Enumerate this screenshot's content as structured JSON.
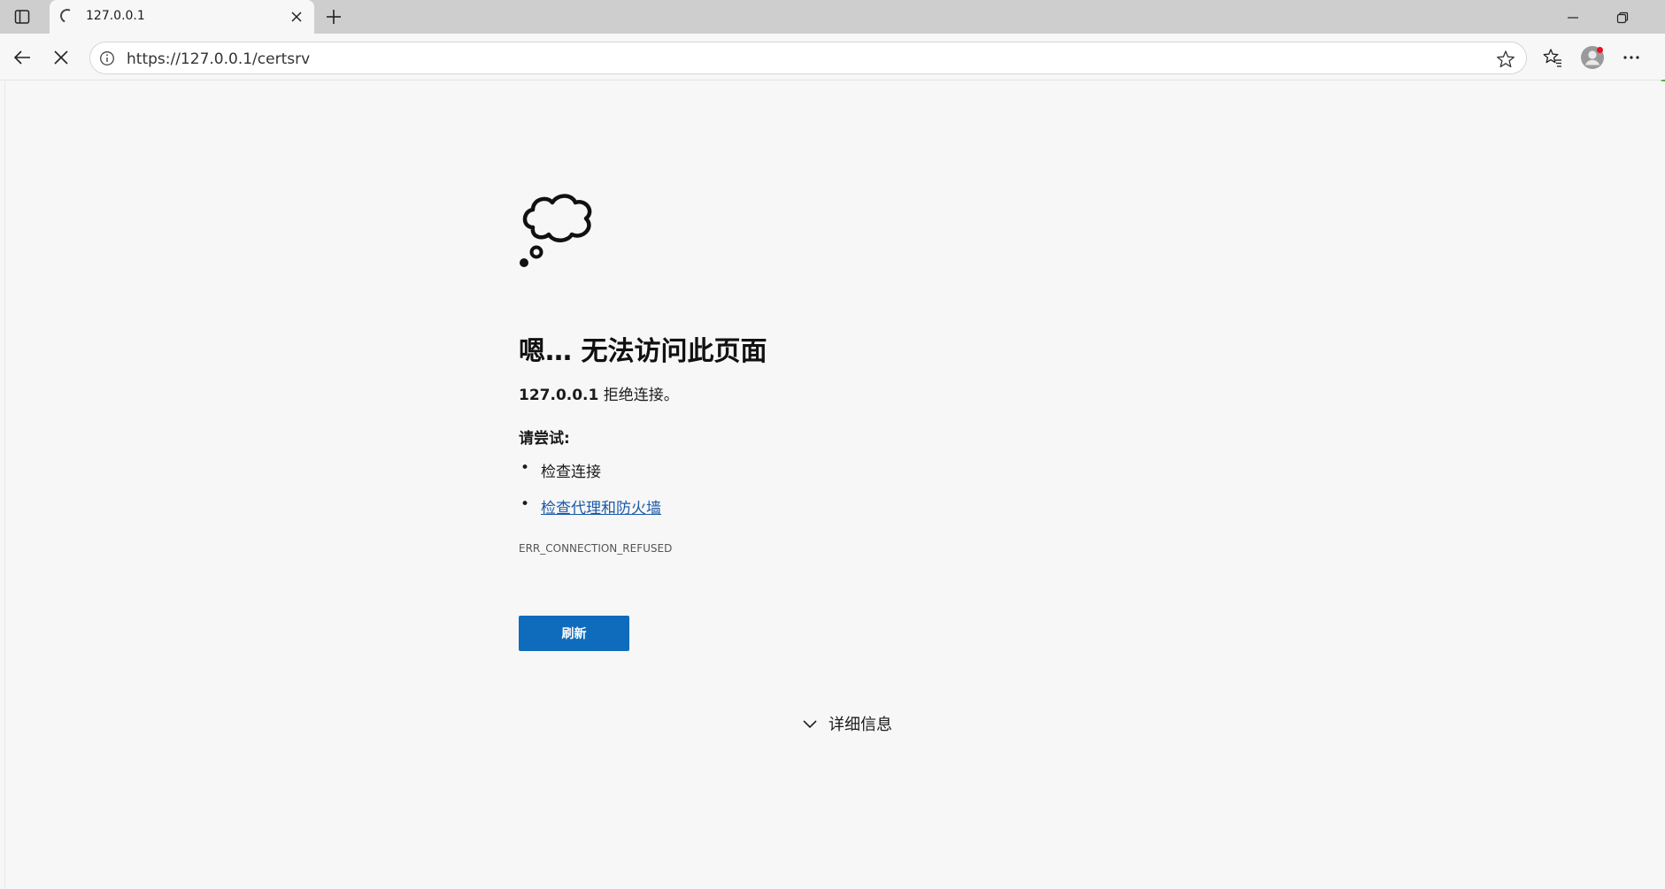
{
  "browser": {
    "tab": {
      "title": "127.0.0.1"
    },
    "address": {
      "url": "https://127.0.0.1/certsrv"
    }
  },
  "error_page": {
    "title": "嗯… 无法访问此页面",
    "host": "127.0.0.1",
    "refused_text": " 拒绝连接。",
    "try_heading": "请尝试:",
    "suggestions": [
      {
        "label": "检查连接",
        "link": false
      },
      {
        "label": "检查代理和防火墙",
        "link": true
      }
    ],
    "error_code": "ERR_CONNECTION_REFUSED",
    "refresh_label": "刷新",
    "details_label": "详细信息"
  },
  "colors": {
    "accent": "#0f6cbd",
    "link": "#1a5aa8",
    "notification_dot": "#e81123"
  }
}
